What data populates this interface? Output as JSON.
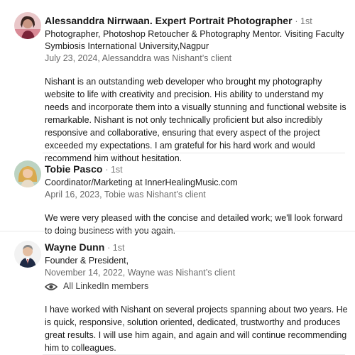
{
  "recommendations": [
    {
      "avatar": "profile-photo",
      "name": "Alessanddra Nirrwaan. Expert Portrait Photographer",
      "degree": "· 1st",
      "headline_1": "Photographer, Photoshop Retoucher & Photography Mentor. Visiting Faculty",
      "headline_2": "Symbiosis International University,Nagpur",
      "meta": "July 23, 2024, Alessanddra was Nishant’s client",
      "text": "Nishant is an outstanding web developer who brought my photography website to life with creativity and precision. His ability to understand my needs and incorporate them into a visually stunning and functional website is remarkable. Nishant is not only technically proficient but also incredibly responsive and collaborative, ensuring that every aspect of the project exceeded my expectations. I am grateful for his hard work and would recommend him without hesitation."
    },
    {
      "avatar": "profile-photo",
      "name": "Tobie Pasco",
      "degree": "· 1st",
      "headline_1": "Coordinator/Marketing at InnerHealingMusic.com",
      "meta": "April 16, 2023, Tobie was Nishant’s client",
      "text": "We were very pleased with the concise and detailed work; we'll look forward to doing business with you again."
    },
    {
      "avatar": "profile-photo",
      "name": "Wayne Dunn",
      "degree": "· 1st",
      "headline_1": "Founder & President,",
      "meta": "November 14, 2022, Wayne was Nishant’s client",
      "visibility_icon": "eye-icon",
      "visibility": "All LinkedIn members",
      "text": "I have worked with Nishant on several projects spanning about two years. He is quick, responsive, solution oriented, dedicated, trustworthy and produces great results. I will use him again, and again and will continue recommending him to colleagues."
    }
  ]
}
